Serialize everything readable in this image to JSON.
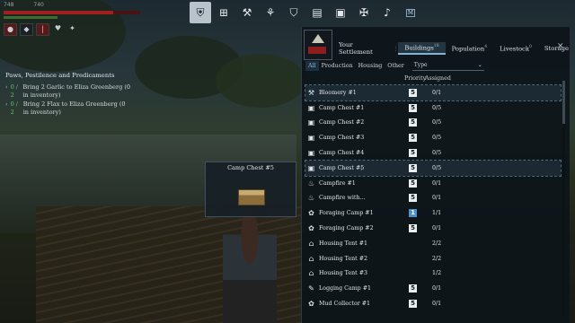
{
  "hud": {
    "stat_left": "748",
    "stat_right": "740"
  },
  "quests": {
    "title": "Paws, Pestilence and Predicaments",
    "items": [
      {
        "progress": "0 / 2",
        "text": "Bring 2 Garlic to Eliza Greenberg (0 in inventory)"
      },
      {
        "progress": "0 / 2",
        "text": "Bring 2 Flax to Eliza Greenberg (0 in inventory)"
      }
    ]
  },
  "topnav": {
    "tag": "M",
    "icons": [
      "settlement-icon",
      "map-icon",
      "build-icon",
      "tech-icon",
      "shield-icon",
      "journal-icon",
      "codex-icon",
      "skills-icon",
      "bell-icon"
    ]
  },
  "panel": {
    "tabs": [
      {
        "label": "Your Settlement",
        "badge": ""
      },
      {
        "label": "Buildings",
        "badge": "18"
      },
      {
        "label": "Population",
        "badge": "4"
      },
      {
        "label": "Livestock",
        "badge": "0"
      },
      {
        "label": "Storage",
        "badge": ""
      }
    ],
    "filters": [
      "All",
      "Production",
      "Housing",
      "Other"
    ],
    "select_value": "Type",
    "col_priority": "Priority",
    "col_assigned": "Assigned",
    "rows": [
      {
        "icon": "⚒",
        "name": "Bloomery #1",
        "priority": "5",
        "assigned": "0/1"
      },
      {
        "icon": "▣",
        "name": "Camp Chest #1",
        "priority": "5",
        "assigned": "0/5"
      },
      {
        "icon": "▣",
        "name": "Camp Chest #2",
        "priority": "5",
        "assigned": "0/5"
      },
      {
        "icon": "▣",
        "name": "Camp Chest #3",
        "priority": "5",
        "assigned": "0/5"
      },
      {
        "icon": "▣",
        "name": "Camp Chest #4",
        "priority": "5",
        "assigned": "0/5"
      },
      {
        "icon": "▣",
        "name": "Camp Chest #5",
        "priority": "5",
        "assigned": "0/5"
      },
      {
        "icon": "♨",
        "name": "Campfire #1",
        "priority": "5",
        "assigned": "0/1"
      },
      {
        "icon": "♨",
        "name": "Campfire with...",
        "priority": "5",
        "assigned": "0/1"
      },
      {
        "icon": "✿",
        "name": "Foraging Camp #1",
        "priority": "1",
        "assigned": "1/1"
      },
      {
        "icon": "✿",
        "name": "Foraging Camp #2",
        "priority": "5",
        "assigned": "0/1"
      },
      {
        "icon": "⌂",
        "name": "Housing Tent #1",
        "priority": "",
        "assigned": "2/2"
      },
      {
        "icon": "⌂",
        "name": "Housing Tent #2",
        "priority": "",
        "assigned": "2/2"
      },
      {
        "icon": "⌂",
        "name": "Housing Tent #3",
        "priority": "",
        "assigned": "1/2"
      },
      {
        "icon": "✎",
        "name": "Logging Camp #1",
        "priority": "5",
        "assigned": "0/1"
      },
      {
        "icon": "✿",
        "name": "Mud Collector #1",
        "priority": "5",
        "assigned": "0/1"
      }
    ]
  },
  "tooltip": {
    "title": "Camp Chest #5"
  }
}
